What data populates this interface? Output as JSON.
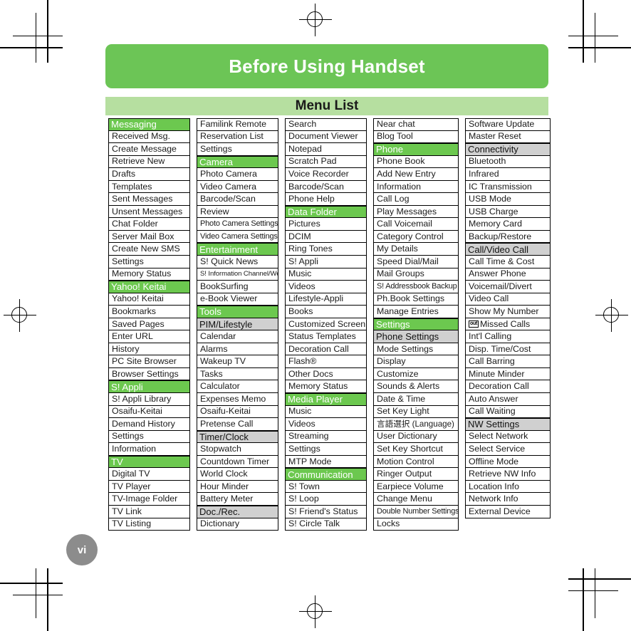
{
  "page": {
    "chapter_title": "Before Using Handset",
    "section_title": "Menu List",
    "page_number": "vi",
    "colors": {
      "chapter_banner": "#6cc556",
      "section_banner": "#b6dfa0",
      "category_header": "#6cc84f",
      "subcategory_header": "#d0d0d0",
      "page_number_bubble": "#8c8c8c"
    }
  },
  "columns": [
    {
      "id": "column-1",
      "items": [
        {
          "label": "Messaging",
          "type": "head"
        },
        {
          "label": "Received Msg.",
          "type": "item"
        },
        {
          "label": "Create Message",
          "type": "item"
        },
        {
          "label": "Retrieve New",
          "type": "item"
        },
        {
          "label": "Drafts",
          "type": "item"
        },
        {
          "label": "Templates",
          "type": "item"
        },
        {
          "label": "Sent Messages",
          "type": "item"
        },
        {
          "label": "Unsent Messages",
          "type": "item"
        },
        {
          "label": "Chat Folder",
          "type": "item"
        },
        {
          "label": "Server Mail Box",
          "type": "item"
        },
        {
          "label": "Create New SMS",
          "type": "item"
        },
        {
          "label": "Settings",
          "type": "item"
        },
        {
          "label": "Memory Status",
          "type": "item"
        },
        {
          "label": "Yahoo! Keitai",
          "type": "head"
        },
        {
          "label": "Yahoo! Keitai",
          "type": "item"
        },
        {
          "label": "Bookmarks",
          "type": "item"
        },
        {
          "label": "Saved Pages",
          "type": "item"
        },
        {
          "label": "Enter URL",
          "type": "item"
        },
        {
          "label": "History",
          "type": "item"
        },
        {
          "label": "PC Site Browser",
          "type": "item"
        },
        {
          "label": "Browser Settings",
          "type": "item"
        },
        {
          "label": "S! Appli",
          "type": "head"
        },
        {
          "label": "S! Appli Library",
          "type": "item"
        },
        {
          "label": "Osaifu-Keitai",
          "type": "item"
        },
        {
          "label": "Demand History",
          "type": "item"
        },
        {
          "label": "Settings",
          "type": "item"
        },
        {
          "label": "Information",
          "type": "item"
        },
        {
          "label": "TV",
          "type": "head"
        },
        {
          "label": "Digital TV",
          "type": "item"
        },
        {
          "label": "TV Player",
          "type": "item"
        },
        {
          "label": "TV-Image Folder",
          "type": "item"
        },
        {
          "label": "TV Link",
          "type": "item"
        },
        {
          "label": "TV Listing",
          "type": "item"
        }
      ]
    },
    {
      "id": "column-2",
      "items": [
        {
          "label": "Familink Remote",
          "type": "item"
        },
        {
          "label": "Reservation List",
          "type": "item"
        },
        {
          "label": "Settings",
          "type": "item"
        },
        {
          "label": "Camera",
          "type": "head"
        },
        {
          "label": "Photo Camera",
          "type": "item"
        },
        {
          "label": "Video Camera",
          "type": "item"
        },
        {
          "label": "Barcode/Scan",
          "type": "item"
        },
        {
          "label": "Review",
          "type": "item"
        },
        {
          "label": "Photo Camera Settings",
          "type": "item",
          "size": "small"
        },
        {
          "label": "Video Camera Settings",
          "type": "item",
          "size": "small"
        },
        {
          "label": "Entertainment",
          "type": "head"
        },
        {
          "label": "S! Quick News",
          "type": "item"
        },
        {
          "label": "S! Information Channel/Weather",
          "type": "item",
          "size": "tiny"
        },
        {
          "label": "BookSurfing",
          "type": "item"
        },
        {
          "label": "e-Book Viewer",
          "type": "item"
        },
        {
          "label": "Tools",
          "type": "head"
        },
        {
          "label": "PIM/Lifestyle",
          "type": "sub"
        },
        {
          "label": "Calendar",
          "type": "item"
        },
        {
          "label": "Alarms",
          "type": "item"
        },
        {
          "label": "Wakeup TV",
          "type": "item"
        },
        {
          "label": "Tasks",
          "type": "item"
        },
        {
          "label": "Calculator",
          "type": "item"
        },
        {
          "label": "Expenses Memo",
          "type": "item"
        },
        {
          "label": "Osaifu-Keitai",
          "type": "item"
        },
        {
          "label": "Pretense Call",
          "type": "item"
        },
        {
          "label": "Timer/Clock",
          "type": "sub"
        },
        {
          "label": "Stopwatch",
          "type": "item"
        },
        {
          "label": "Countdown Timer",
          "type": "item"
        },
        {
          "label": "World Clock",
          "type": "item"
        },
        {
          "label": "Hour Minder",
          "type": "item"
        },
        {
          "label": "Battery Meter",
          "type": "item"
        },
        {
          "label": "Doc./Rec.",
          "type": "sub"
        },
        {
          "label": "Dictionary",
          "type": "item"
        }
      ]
    },
    {
      "id": "column-3",
      "items": [
        {
          "label": "Search",
          "type": "item"
        },
        {
          "label": "Document Viewer",
          "type": "item"
        },
        {
          "label": "Notepad",
          "type": "item"
        },
        {
          "label": "Scratch Pad",
          "type": "item"
        },
        {
          "label": "Voice Recorder",
          "type": "item"
        },
        {
          "label": "Barcode/Scan",
          "type": "item"
        },
        {
          "label": "Phone Help",
          "type": "item"
        },
        {
          "label": "Data Folder",
          "type": "head"
        },
        {
          "label": "Pictures",
          "type": "item"
        },
        {
          "label": "DCIM",
          "type": "item"
        },
        {
          "label": "Ring Tones",
          "type": "item"
        },
        {
          "label": "S! Appli",
          "type": "item"
        },
        {
          "label": "Music",
          "type": "item"
        },
        {
          "label": "Videos",
          "type": "item"
        },
        {
          "label": "Lifestyle-Appli",
          "type": "item"
        },
        {
          "label": "Books",
          "type": "item"
        },
        {
          "label": "Customized Screen",
          "type": "item"
        },
        {
          "label": "Status Templates",
          "type": "item"
        },
        {
          "label": "Decoration Call",
          "type": "item"
        },
        {
          "label": "Flash®",
          "type": "item"
        },
        {
          "label": "Other Docs",
          "type": "item"
        },
        {
          "label": "Memory Status",
          "type": "item"
        },
        {
          "label": "Media Player",
          "type": "head"
        },
        {
          "label": "Music",
          "type": "item"
        },
        {
          "label": "Videos",
          "type": "item"
        },
        {
          "label": "Streaming",
          "type": "item"
        },
        {
          "label": "Settings",
          "type": "item"
        },
        {
          "label": "MTP Mode",
          "type": "item"
        },
        {
          "label": "Communication",
          "type": "head"
        },
        {
          "label": "S! Town",
          "type": "item"
        },
        {
          "label": "S! Loop",
          "type": "item"
        },
        {
          "label": "S! Friend's Status",
          "type": "item"
        },
        {
          "label": "S! Circle Talk",
          "type": "item"
        }
      ]
    },
    {
      "id": "column-4",
      "items": [
        {
          "label": "Near chat",
          "type": "item"
        },
        {
          "label": "Blog Tool",
          "type": "item"
        },
        {
          "label": "Phone",
          "type": "head"
        },
        {
          "label": "Phone Book",
          "type": "item"
        },
        {
          "label": "Add New Entry",
          "type": "item"
        },
        {
          "label": "Information",
          "type": "item"
        },
        {
          "label": "Call Log",
          "type": "item"
        },
        {
          "label": "Play Messages",
          "type": "item"
        },
        {
          "label": "Call Voicemail",
          "type": "item"
        },
        {
          "label": "Category Control",
          "type": "item"
        },
        {
          "label": "My Details",
          "type": "item"
        },
        {
          "label": "Speed Dial/Mail",
          "type": "item"
        },
        {
          "label": "Mail Groups",
          "type": "item"
        },
        {
          "label": "S! Addressbook Backup",
          "type": "item",
          "size": "small"
        },
        {
          "label": "Ph.Book Settings",
          "type": "item"
        },
        {
          "label": "Manage Entries",
          "type": "item"
        },
        {
          "label": "Settings",
          "type": "head"
        },
        {
          "label": "Phone Settings",
          "type": "sub"
        },
        {
          "label": "Mode Settings",
          "type": "item"
        },
        {
          "label": "Display",
          "type": "item"
        },
        {
          "label": "Customize",
          "type": "item"
        },
        {
          "label": "Sounds & Alerts",
          "type": "item"
        },
        {
          "label": "Date & Time",
          "type": "item"
        },
        {
          "label": "Set Key Light",
          "type": "item"
        },
        {
          "label": "言語選択 (Language)",
          "type": "item",
          "size": "cjk"
        },
        {
          "label": "User Dictionary",
          "type": "item"
        },
        {
          "label": "Set Key Shortcut",
          "type": "item"
        },
        {
          "label": "Motion Control",
          "type": "item"
        },
        {
          "label": "Ringer Output",
          "type": "item"
        },
        {
          "label": "Earpiece Volume",
          "type": "item"
        },
        {
          "label": "Change Menu",
          "type": "item"
        },
        {
          "label": "Double Number Settings",
          "type": "item",
          "size": "small"
        },
        {
          "label": "Locks",
          "type": "item"
        }
      ]
    },
    {
      "id": "column-5",
      "items": [
        {
          "label": "Software Update",
          "type": "item"
        },
        {
          "label": "Master Reset",
          "type": "item"
        },
        {
          "label": "Connectivity",
          "type": "sub"
        },
        {
          "label": "Bluetooth",
          "type": "item"
        },
        {
          "label": "Infrared",
          "type": "item"
        },
        {
          "label": "IC Transmission",
          "type": "item"
        },
        {
          "label": "USB Mode",
          "type": "item"
        },
        {
          "label": "USB Charge",
          "type": "item"
        },
        {
          "label": "Memory Card",
          "type": "item"
        },
        {
          "label": "Backup/Restore",
          "type": "item"
        },
        {
          "label": "Call/Video Call",
          "type": "sub"
        },
        {
          "label": "Call Time & Cost",
          "type": "item"
        },
        {
          "label": "Answer Phone",
          "type": "item"
        },
        {
          "label": "Voicemail/Divert",
          "type": "item"
        },
        {
          "label": "Video Call",
          "type": "item"
        },
        {
          "label": "Show My Number",
          "type": "item"
        },
        {
          "label": "Missed Calls",
          "type": "item",
          "badge": "out"
        },
        {
          "label": "Int'l Calling",
          "type": "item"
        },
        {
          "label": "Disp. Time/Cost",
          "type": "item"
        },
        {
          "label": "Call Barring",
          "type": "item"
        },
        {
          "label": "Minute Minder",
          "type": "item"
        },
        {
          "label": "Decoration Call",
          "type": "item"
        },
        {
          "label": "Auto Answer",
          "type": "item"
        },
        {
          "label": "Call Waiting",
          "type": "item"
        },
        {
          "label": "NW Settings",
          "type": "sub"
        },
        {
          "label": "Select Network",
          "type": "item"
        },
        {
          "label": "Select Service",
          "type": "item"
        },
        {
          "label": "Offline Mode",
          "type": "item"
        },
        {
          "label": "Retrieve NW Info",
          "type": "item"
        },
        {
          "label": "Location Info",
          "type": "item"
        },
        {
          "label": "Network Info",
          "type": "item"
        },
        {
          "label": "External Device",
          "type": "item"
        }
      ]
    }
  ]
}
